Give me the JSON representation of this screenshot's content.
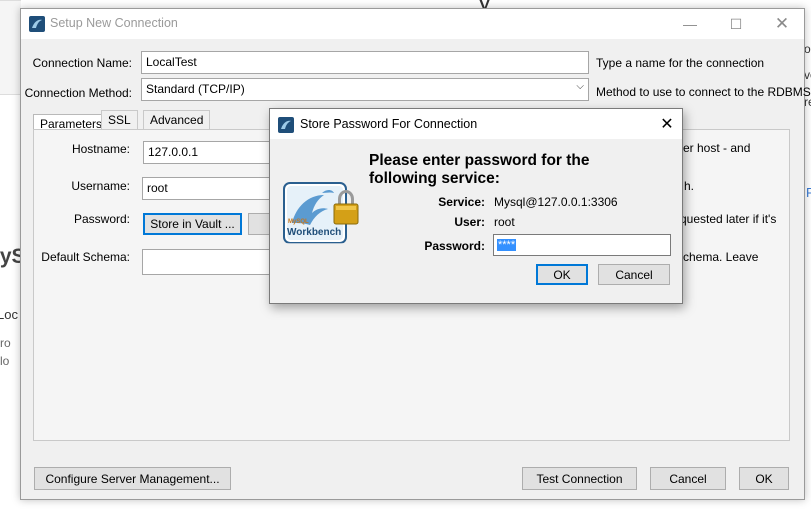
{
  "background": {
    "frag_ys": "y",
    "frag_lys": "lyS",
    "frag_loc": "Loc",
    "frag_ro": "ro",
    "frag_lo": "lo",
    "frag_o": "o",
    "frag_ve": "ve",
    "frag_re": "re",
    "frag_f": "F"
  },
  "main_dialog": {
    "title": "Setup New Connection",
    "connection_name_label": "Connection Name:",
    "connection_name_value": "LocalTest",
    "connection_name_hint": "Type a name for the connection",
    "connection_method_label": "Connection Method:",
    "connection_method_value": "Standard (TCP/IP)",
    "connection_method_hint": "Method to use to connect to the RDBMS",
    "tabs": [
      "Parameters",
      "SSL",
      "Advanced"
    ],
    "hostname_label": "Hostname:",
    "hostname_value": "127.0.0.1",
    "hostname_hint": "er host - and",
    "username_label": "Username:",
    "username_value": "root",
    "username_hint": "h.",
    "password_label": "Password:",
    "store_vault_label": "Store in Vault ...",
    "password_hint": "quested later if it's",
    "default_schema_label": "Default Schema:",
    "default_schema_hint": "chema. Leave",
    "configure_server_label": "Configure Server Management...",
    "test_connection_label": "Test Connection",
    "cancel_label": "Cancel",
    "ok_label": "OK"
  },
  "password_dialog": {
    "title": "Store Password For Connection",
    "heading_line1": "Please enter password for the",
    "heading_line2": "following service:",
    "service_label": "Service:",
    "service_value": "Mysql@127.0.0.1:3306",
    "user_label": "User:",
    "user_value": "root",
    "password_label": "Password:",
    "password_value": "****",
    "ok_label": "OK",
    "cancel_label": "Cancel",
    "logo_text_top": "MySQL",
    "logo_text_bottom": "Workbench"
  },
  "colors": {
    "accent": "#0078d7",
    "selection": "#3390ff",
    "dialog_bg": "#f0f0f0"
  }
}
